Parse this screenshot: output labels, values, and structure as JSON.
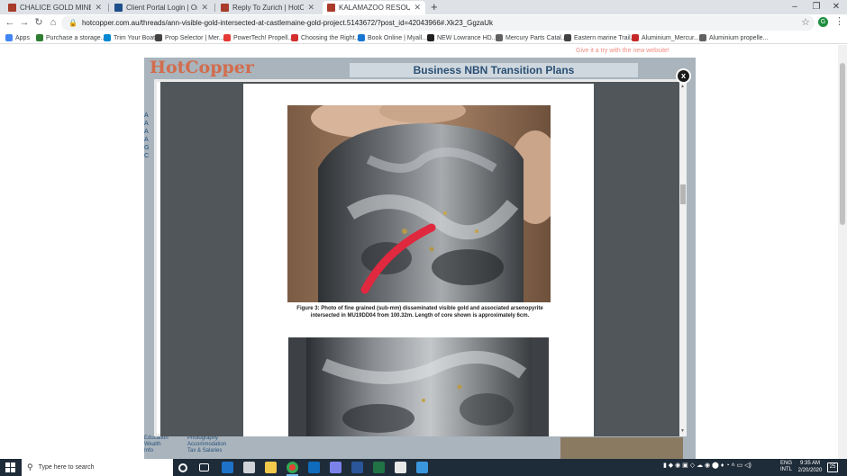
{
  "browser": {
    "tabs": [
      {
        "title": "CHALICE GOLD MINES LIMITED (",
        "color": "#a83b2a"
      },
      {
        "title": "Client Portal Login | Ord Minnett",
        "color": "#1f4e8c"
      },
      {
        "title": "Reply To Zurich | HotCopper For",
        "color": "#a83b2a"
      },
      {
        "title": "KALAMAZOO RESOURCES LIMIT",
        "color": "#a83b2a"
      }
    ],
    "new_tab": "+",
    "minimize": "–",
    "maximize": "❐",
    "close": "✕",
    "url": "hotcopper.com.au/threads/ann-visible-gold-intersected-at-castlemaine-gold-project.5143672/?post_id=42043966#.Xk23_GgzaUk",
    "profile_initial": "G"
  },
  "bookmarks": [
    {
      "label": "Apps",
      "color": "#4285f4"
    },
    {
      "label": "Purchase a storage...",
      "color": "#2e7d32"
    },
    {
      "label": "Trim Your Boat",
      "color": "#0288d1"
    },
    {
      "label": "Prop Selector | Mer...",
      "color": "#424242"
    },
    {
      "label": "PowerTech! Propell...",
      "color": "#e53935"
    },
    {
      "label": "Choosing the Right...",
      "color": "#d32f2f"
    },
    {
      "label": "Book Online | Myall...",
      "color": "#1976d2"
    },
    {
      "label": "NEW Lowrance HD...",
      "color": "#212121"
    },
    {
      "label": "Mercury Parts Catal...",
      "color": "#616161"
    },
    {
      "label": "Eastern marine Trail...",
      "color": "#424242"
    },
    {
      "label": "Aluminium_Mercur...",
      "color": "#c62828"
    },
    {
      "label": "Aluminium propelle...",
      "color": "#616161"
    }
  ],
  "page": {
    "promo": "Give it a try with the new website!",
    "logo": "HotCopper",
    "banner": "Business NBN Transition Plans",
    "side_letters": [
      "A",
      "A",
      "A",
      "A",
      "G",
      "C"
    ],
    "footer_left": [
      "Education",
      "Wealth",
      "Info"
    ],
    "footer_mid": [
      "Photography",
      "Accommodation",
      "Tax & Salaries"
    ]
  },
  "lightbox": {
    "close": "x",
    "caption": "Figure 3: Photo of fine grained (sub-mm) disseminated visible gold and associated arsenopyrite intersected in MU19DD04 from 100.32m. Length of core shown is approximately 6cm."
  },
  "taskbar": {
    "search_placeholder": "Type here to search",
    "language": "ENG",
    "layout": "INTL",
    "time": "9:35 AM",
    "date": "2/20/2020",
    "notifications": "25"
  }
}
